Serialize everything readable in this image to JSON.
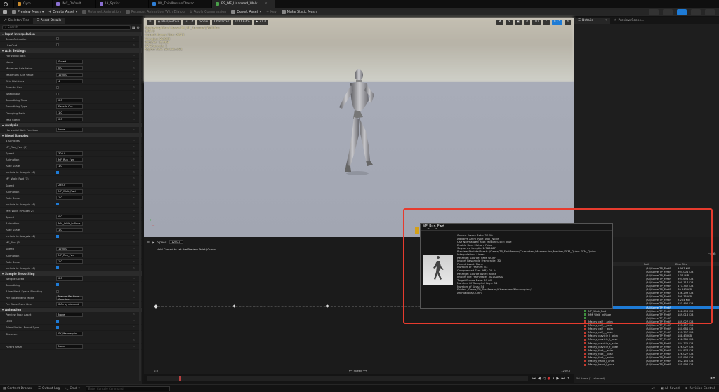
{
  "tabs": [
    {
      "label": "Gym",
      "color": "#c98a2b"
    },
    {
      "label": "IMC_Default",
      "color": "#8a6fd1"
    },
    {
      "label": "IA_Sprint",
      "color": "#8a6fd1"
    },
    {
      "label": "BP_ThirdPersonCharac...",
      "color": "#2f7fd6"
    },
    {
      "label": "BS_MF_Unarmed_Walk...",
      "color": "#4aa04a"
    }
  ],
  "toolbar": {
    "save": "",
    "preview_mesh": "Preview Mesh",
    "create_asset": "Create Asset",
    "retarget_animation": "Retarget Animation",
    "retarget_dialog": "Retarget Animation With Dialog",
    "apply_compression": "Apply Compression",
    "export_asset": "Export Asset",
    "key": "Key",
    "make_static_mesh": "Make Static Mesh"
  },
  "left_panel": {
    "tab_skeleton": "Skeleton Tree",
    "tab_asset": "Asset Details",
    "search_placeholder": "Search",
    "sections": [
      {
        "title": "Input Interpolation",
        "rows": [
          {
            "label": "Scale Animation",
            "value": "",
            "check": false
          },
          {
            "label": "Use Grid",
            "value": "",
            "check": false
          }
        ]
      },
      {
        "title": "Axis Settings",
        "rows": [
          {
            "label": "Horizontal Axis",
            "value": "",
            "check": null
          },
          {
            "label": "Name",
            "value": "Speed",
            "check": null
          },
          {
            "label": "Minimum Axis Value",
            "value": "0.0",
            "check": null
          },
          {
            "label": "Maximum Axis Value",
            "value": "1200.0",
            "check": null
          },
          {
            "label": "Grid Divisions",
            "value": "4",
            "check": null
          },
          {
            "label": "Snap to Grid",
            "value": "",
            "check": false
          },
          {
            "label": "Wrap Input",
            "value": "",
            "check": false
          },
          {
            "label": "Smoothing Time",
            "value": "0.0",
            "check": null
          },
          {
            "label": "Smoothing Type",
            "value": "Ease In Out",
            "check": null
          },
          {
            "label": "Damping Ratio",
            "value": "1.0",
            "check": null
          },
          {
            "label": "Max Speed",
            "value": "0.0",
            "check": null
          }
        ]
      },
      {
        "title": "Analysis",
        "rows": [
          {
            "label": "Horizontal Axis Function",
            "value": "None",
            "check": null
          }
        ]
      },
      {
        "title": "Blend Samples",
        "rows": [
          {
            "label": "4 Samples",
            "value": "",
            "check": null
          },
          {
            "label": "MF_Run_Fwd (0)",
            "value": "",
            "check": null
          },
          {
            "label": "Speed",
            "value": "300.0",
            "check": null
          },
          {
            "label": "Animation",
            "value": "MF_Run_Fwd",
            "check": null
          },
          {
            "label": "Rate Scale",
            "value": "1.0",
            "check": null
          },
          {
            "label": "Include in Analysis (4)",
            "value": "",
            "check": true
          },
          {
            "label": "MF_Walk_Fwd (1)",
            "value": "",
            "check": null
          },
          {
            "label": "Speed",
            "value": "230.0",
            "check": null
          },
          {
            "label": "Animation",
            "value": "MF_Walk_Fwd",
            "check": null
          },
          {
            "label": "Rate Scale",
            "value": "1.0",
            "check": null
          },
          {
            "label": "Include in Analysis (4)",
            "value": "",
            "check": true
          },
          {
            "label": "MM_Walk_InPlace (2)",
            "value": "",
            "check": null
          },
          {
            "label": "Speed",
            "value": "0.0",
            "check": null
          },
          {
            "label": "Animation",
            "value": "MM_Walk_InPlace",
            "check": null
          },
          {
            "label": "Rate Scale",
            "value": "1.0",
            "check": null
          },
          {
            "label": "Include in Analysis (4)",
            "value": "",
            "check": true
          },
          {
            "label": "MF_Run (3)",
            "value": "",
            "check": null
          },
          {
            "label": "Speed",
            "value": "1200.0",
            "check": null
          },
          {
            "label": "Animation",
            "value": "MF_Run_Fwd",
            "check": null
          },
          {
            "label": "Rate Scale",
            "value": "1.0",
            "check": null
          },
          {
            "label": "Include in Analysis (4)",
            "value": "",
            "check": true
          }
        ]
      },
      {
        "title": "Sample Smoothing",
        "rows": [
          {
            "label": "Weight Speed",
            "value": "0.0",
            "check": null
          },
          {
            "label": "Smoothing",
            "value": "",
            "check": true
          },
          {
            "label": "Allow Mesh Space Blending",
            "value": "",
            "check": false
          },
          {
            "label": "Per Bone Blend Mode",
            "value": "Manual Per Bone Override",
            "check": null
          },
          {
            "label": "Per Bone Overrides",
            "value": "0 Array element",
            "check": null
          }
        ]
      },
      {
        "title": "Animation",
        "rows": [
          {
            "label": "Preview Pose Asset",
            "value": "None",
            "check": null
          },
          {
            "label": "Loop",
            "value": "",
            "check": true
          },
          {
            "label": "Allow Marker Based Sync",
            "value": "",
            "check": true
          },
          {
            "label": "Skeleton",
            "value": "SK_Mannequin",
            "check": null
          },
          {
            "label": "",
            "value": "",
            "check": null
          },
          {
            "label": "Parent Asset",
            "value": "None",
            "check": null
          }
        ]
      }
    ]
  },
  "viewport": {
    "perspective": "Perspective",
    "lit": "Lit",
    "show": "Show",
    "character": "Character",
    "lod": "LOD Auto",
    "speed": "x1.0",
    "overlay": [
      "Previewing Blend Space BS_MF_Unarmed_WalkRun",
      "LOD: 0",
      "Current Screen Size: 0.853",
      "Triangles: 26,998",
      "Vertices: 18,869",
      "UV Channels: 1",
      "Approx Size: 53x131x181"
    ],
    "right_icons": [
      "10",
      "0.25",
      "4"
    ]
  },
  "details": {
    "tab1": "Details",
    "tab2": "Preview Scene..."
  },
  "blendspace": {
    "speed_label": "Speed",
    "speed_value": "1200.0",
    "hint": "Hold Control to set the Preview Point (Green)",
    "axis_min": "0.0",
    "axis_max": "1200.0",
    "axis_name": "Speed"
  },
  "asset_browser": {
    "col_path": "Path",
    "col_size": "Disk Size",
    "items": [
      {
        "name": "",
        "path": "/All/Game/TP_FirstP",
        "size": "9.933 KiB",
        "color": "#3d8f3d",
        "selected": false
      },
      {
        "name": "",
        "path": "/All/Game/TP_FirstP",
        "size": "904.004 KiB",
        "color": "#3d8f3d",
        "selected": false
      },
      {
        "name": "",
        "path": "/All/Game/TP_FirstP",
        "size": "1.37 MiB",
        "color": "#3d8f3d",
        "selected": false
      },
      {
        "name": "",
        "path": "/All/Game/TP_FirstP",
        "size": "394.698 KiB",
        "color": "#3d8f3d",
        "selected": false
      },
      {
        "name": "",
        "path": "/All/Game/TP_FirstP",
        "size": "400.117 KiB",
        "color": "#3d8f3d",
        "selected": false
      },
      {
        "name": "",
        "path": "/All/Game/TP_FirstP",
        "size": "471.342 KiB",
        "color": "#3d8f3d",
        "selected": false
      },
      {
        "name": "",
        "path": "/All/Game/TP_FirstP",
        "size": "89.343 KiB",
        "color": "#3d8f3d",
        "selected": false
      },
      {
        "name": "",
        "path": "/All/Game/TP_FirstP",
        "size": "536.299 KiB",
        "color": "#3d8f3d",
        "selected": false
      },
      {
        "name": "",
        "path": "/All/Game/TP_FirstP",
        "size": "699.35 KiB",
        "color": "#3d8f3d",
        "selected": false
      },
      {
        "name": "WalkRun",
        "path": "/All/Game/TP_FirstP",
        "size": "9.204 KiB",
        "color": "#3d8f3d",
        "selected": false
      },
      {
        "name": "",
        "path": "/All/Game/TP_FirstP",
        "size": "931.496 KiB",
        "color": "#3d8f3d",
        "selected": false
      },
      {
        "name": "MF_Run_Fwd",
        "path": "/All/Game/TP_FirstP",
        "size": "",
        "color": "#3d8f3d",
        "selected": true
      },
      {
        "name": "MF_Walk_Fwd",
        "path": "/All/Game/TP_FirstP",
        "size": "608.698 KiB",
        "color": "#3d8f3d",
        "selected": false
      },
      {
        "name": "MM_Walk_InPlace",
        "path": "/All/Game/TP_FirstP",
        "size": "189.018 KiB",
        "color": "#3d8f3d",
        "selected": false
      },
      {
        "name": "",
        "path": "/All/Game/TP_FirstP",
        "size": "",
        "color": "#3d8f3d",
        "selected": false
      },
      {
        "name": "Manny_calf_l_anim",
        "path": "/All/Game/TP_FirstP",
        "size": "189.027 KiB",
        "color": "#c23a2f",
        "selected": false
      },
      {
        "name": "Manny_calf_l_pose",
        "path": "/All/Game/TP_FirstP",
        "size": "195.457 KiB",
        "color": "#c23a2f",
        "selected": false
      },
      {
        "name": "Manny_calf_r_anim",
        "path": "/All/Game/TP_FirstP",
        "size": "180.684 KiB",
        "color": "#c23a2f",
        "selected": false
      },
      {
        "name": "Manny_calf_r_pose",
        "path": "/All/Game/TP_FirstP",
        "size": "197.797 KiB",
        "color": "#c23a2f",
        "selected": false
      },
      {
        "name": "Manny_clavicle_l_anim",
        "path": "/All/Game/TP_FirstP",
        "size": "188.43 KiB",
        "color": "#c23a2f",
        "selected": false
      },
      {
        "name": "Manny_clavicle_l_pose",
        "path": "/All/Game/TP_FirstP",
        "size": "198.385 KiB",
        "color": "#c23a2f",
        "selected": false
      },
      {
        "name": "Manny_clavicle_r_anim",
        "path": "/All/Game/TP_FirstP",
        "size": "184.775 KiB",
        "color": "#c23a2f",
        "selected": false
      },
      {
        "name": "Manny_clavicle_r_pose",
        "path": "/All/Game/TP_FirstP",
        "size": "126.027 KiB",
        "color": "#c23a2f",
        "selected": false
      },
      {
        "name": "Manny_foot_l_anim",
        "path": "/All/Game/TP_FirstP",
        "size": "184.877 KiB",
        "color": "#c23a2f",
        "selected": false
      },
      {
        "name": "Manny_foot_l_pose",
        "path": "/All/Game/TP_FirstP",
        "size": "126.027 KiB",
        "color": "#c23a2f",
        "selected": false
      },
      {
        "name": "Manny_foot_r_anim",
        "path": "/All/Game/TP_FirstP",
        "size": "185.994 KiB",
        "color": "#c23a2f",
        "selected": false
      },
      {
        "name": "Manny_hand_l_anim",
        "path": "/All/Game/TP_FirstP",
        "size": "162.156 KiB",
        "color": "#c23a2f",
        "selected": false
      },
      {
        "name": "Manny_hand_l_pose",
        "path": "/All/Game/TP_FirstP",
        "size": "185.996 KiB",
        "color": "#c23a2f",
        "selected": false
      }
    ],
    "footer": "56 items (1 selected)"
  },
  "tooltip": {
    "title": "MF_Run_Fwd",
    "lines": [
      "Source Frame Rate: 30.00",
      "Additive Anim Type: AAT_None",
      "Use Normalized Root Motion Scale: True",
      "Enable Root Motion: False",
      "Sequence Length: 1.766667",
      "Preview Skeletal Mesh: /Game/TP_FirstPerson/Characters/Mannequins/Meshes/SKM_Quinn.SKM_Quinn",
      "Interpolation: Linear",
      "Retarget Source: SKM_Quinn",
      "Import Resample Framerate: 30",
      "Parent Asset: None",
      "Number of Frames: 53",
      "Compressed Size (KB): 29.54",
      "Retarget Source Asset: None",
      "Import File Framerate: 30.000000",
      "Target Frame Rate: 30.00",
      "Number Of Sampled Keys: 54",
      "Number of Keys: 54",
      "Folder: /Game/TP_FirstPerson/Characters/Mannequins/",
      "          Animations/Quinn"
    ]
  },
  "statusbar": {
    "content_drawer": "Content Drawer",
    "output_log": "Output Log",
    "cmd": "Cmd",
    "console_placeholder": "Enter Console Command",
    "all_saved": "All Saved",
    "revision_control": "Revision Control"
  },
  "accent": "#1e7bd6",
  "highlight_color": "#e63b2e"
}
